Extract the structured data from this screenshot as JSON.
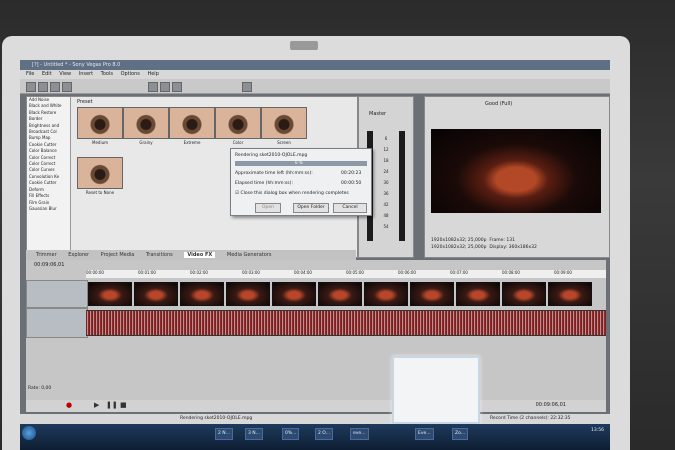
{
  "window": {
    "title": "[?] - Untitled * - Sony Vegas Pro 8.0"
  },
  "menu": [
    "File",
    "Edit",
    "View",
    "Insert",
    "Tools",
    "Options",
    "Help"
  ],
  "effects": {
    "preset_label": "Preset",
    "list": [
      "Add Noise",
      "Black and White",
      "Black Restore",
      "Border",
      "Brightness and",
      "Broadcast Col",
      "Bump Map",
      "Cookie Cutter",
      "Color Balance",
      "Color Correct",
      "Color Correct",
      "Color Curves",
      "Convolution Ke",
      "Cookie Cutter",
      "Deform",
      "Fill Effects",
      "Film Grain",
      "Gaussian Blur"
    ],
    "presets": [
      "Medium",
      "Grainy",
      "Extreme",
      "Color",
      "Screen",
      "Reset to None"
    ]
  },
  "tabs": [
    "Trimmer",
    "Explorer",
    "Project Media",
    "Transitions",
    "Video FX",
    "Media Generators"
  ],
  "mixer": {
    "label": "Master",
    "scale": [
      "6",
      "12",
      "18",
      "24",
      "30",
      "36",
      "42",
      "48",
      "54"
    ]
  },
  "preview": {
    "quality": "Good (Full)",
    "project": "1920x1082x32; 25,000p",
    "preview_res": "1920x1082x32; 25,000p",
    "frame_label": "Frame:",
    "frame": "131",
    "display_label": "Display:",
    "display": "360x186x32"
  },
  "dialog": {
    "title": "Rendering sket2010-OJOLE.mpg",
    "percent": "0 %",
    "approx_label": "Approximate time left (hh:mm:ss):",
    "approx": "00:20:23",
    "elapsed_label": "Elapsed time (hh:mm:ss):",
    "elapsed": "00:00:50",
    "checkbox": "Close this dialog box when rendering completes",
    "open": "Open",
    "open_folder": "Open Folder",
    "cancel": "Cancel"
  },
  "timeline": {
    "cursor": "00:09:06,01",
    "ticks": [
      "00:00:00",
      "00:01:00",
      "00:02:00",
      "00:03:00",
      "00:04:00",
      "00:05:00",
      "00:06:00",
      "00:07:00",
      "00:08:00",
      "00:09:00"
    ],
    "rate": "Rate: 0,00",
    "end_time": "00:09:06,01"
  },
  "status": {
    "left": "Rendering sket2010-OJOLE.mpg",
    "right": "Record Time (2 channels): 22:32:35"
  },
  "taskbar": {
    "items": [
      "2 N...",
      "3 N...",
      "0%...",
      "2 O...",
      "eve...",
      "Eve...",
      "Zo..."
    ],
    "clock": "13:56"
  }
}
